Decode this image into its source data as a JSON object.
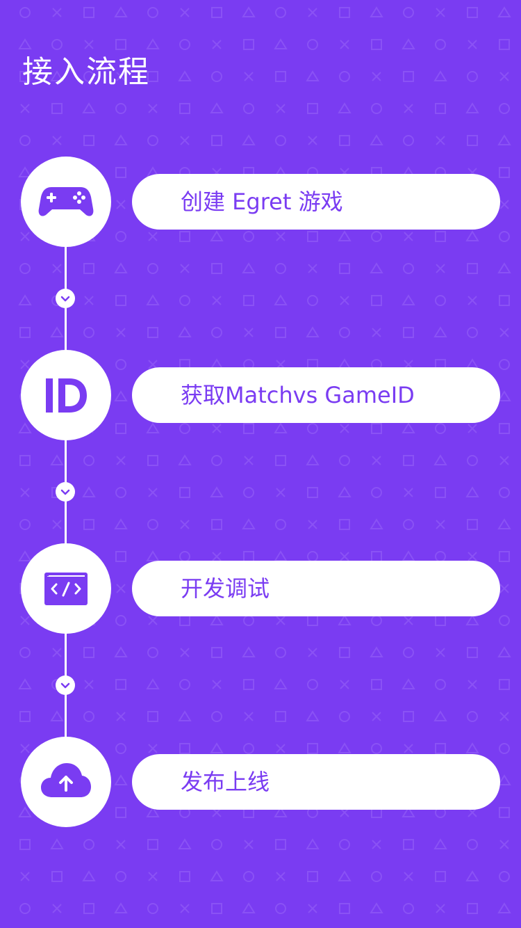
{
  "page": {
    "title": "接入流程"
  },
  "theme": {
    "background": "#7a3cf2",
    "pattern": "#8a52f5",
    "card": "#ffffff",
    "accent": "#7a3cf2"
  },
  "steps": [
    {
      "label": "创建 Egret 游戏",
      "icon": "gamepad-icon"
    },
    {
      "label": "获取Matchvs GameID",
      "icon": "id-icon"
    },
    {
      "label": "开发调试",
      "icon": "code-window-icon"
    },
    {
      "label": "发布上线",
      "icon": "cloud-upload-icon"
    }
  ],
  "connectors": [
    {
      "icon": "chevron-down-icon"
    },
    {
      "icon": "chevron-down-icon"
    },
    {
      "icon": "chevron-down-icon"
    }
  ]
}
